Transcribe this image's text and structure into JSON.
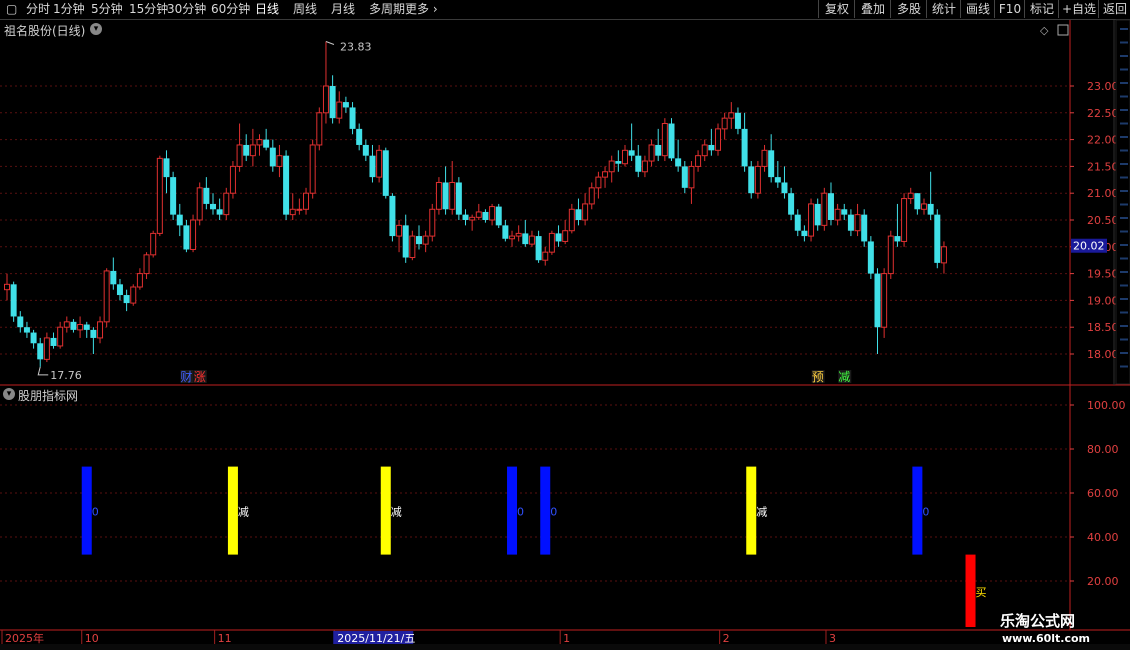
{
  "toolbar": {
    "periods": [
      "分时",
      "1分钟",
      "5分钟",
      "15分钟",
      "30分钟",
      "60分钟",
      "日线",
      "周线",
      "月线",
      "多周期",
      "更多"
    ],
    "active_period": "日线",
    "right_buttons": [
      "复权",
      "叠加",
      "多股",
      "统计",
      "画线",
      "F10",
      "标记",
      "+自选",
      "返回"
    ]
  },
  "stock": {
    "title": "祖名股份(日线)"
  },
  "indicator": {
    "title": "股朋指标网"
  },
  "colors": {
    "up": "#e03030",
    "down": "#40e0e8",
    "grid": "#5a1010",
    "axis": "#e04040"
  },
  "chart_data": [
    {
      "type": "candlestick",
      "title": "祖名股份(日线)",
      "y_ticks": [
        18.0,
        18.5,
        19.0,
        19.5,
        20.0,
        20.5,
        21.0,
        21.5,
        22.0,
        22.5,
        23.0
      ],
      "ylim": [
        17.4,
        23.95
      ],
      "current_price": "20.02",
      "max_label": "23.83",
      "min_label": "17.76",
      "event_markers": [
        {
          "index": 27,
          "text": "财",
          "color": "#4060ff"
        },
        {
          "index": 29,
          "text": "涨",
          "color": "#ff3030"
        },
        {
          "index": 122,
          "text": "预",
          "color": "#ffd040"
        },
        {
          "index": 126,
          "text": "减",
          "color": "#40ff40"
        }
      ],
      "candles": [
        [
          19.2,
          19.5,
          19.0,
          19.3
        ],
        [
          19.3,
          19.35,
          18.6,
          18.7
        ],
        [
          18.7,
          18.8,
          18.4,
          18.5
        ],
        [
          18.5,
          18.6,
          18.3,
          18.4
        ],
        [
          18.4,
          18.45,
          18.1,
          18.2
        ],
        [
          18.2,
          18.3,
          17.76,
          17.9
        ],
        [
          17.9,
          18.4,
          17.85,
          18.3
        ],
        [
          18.3,
          18.4,
          18.1,
          18.15
        ],
        [
          18.15,
          18.6,
          18.1,
          18.5
        ],
        [
          18.5,
          18.7,
          18.4,
          18.6
        ],
        [
          18.6,
          18.65,
          18.4,
          18.45
        ],
        [
          18.45,
          18.7,
          18.3,
          18.55
        ],
        [
          18.55,
          18.6,
          18.3,
          18.45
        ],
        [
          18.45,
          18.5,
          18.0,
          18.3
        ],
        [
          18.3,
          18.7,
          18.2,
          18.6
        ],
        [
          18.6,
          19.6,
          18.5,
          19.55
        ],
        [
          19.55,
          19.8,
          19.2,
          19.3
        ],
        [
          19.3,
          19.4,
          19.0,
          19.1
        ],
        [
          19.1,
          19.2,
          18.8,
          18.95
        ],
        [
          18.95,
          19.3,
          18.9,
          19.25
        ],
        [
          19.25,
          19.6,
          19.2,
          19.5
        ],
        [
          19.5,
          19.9,
          19.4,
          19.85
        ],
        [
          19.85,
          20.3,
          19.8,
          20.25
        ],
        [
          20.25,
          21.7,
          20.2,
          21.65
        ],
        [
          21.65,
          21.8,
          21.0,
          21.3
        ],
        [
          21.3,
          21.4,
          20.5,
          20.6
        ],
        [
          20.6,
          20.8,
          20.2,
          20.4
        ],
        [
          20.4,
          20.5,
          19.9,
          19.95
        ],
        [
          19.95,
          20.6,
          19.9,
          20.5
        ],
        [
          20.5,
          21.2,
          20.4,
          21.1
        ],
        [
          21.1,
          21.3,
          20.7,
          20.8
        ],
        [
          20.8,
          21.0,
          20.6,
          20.7
        ],
        [
          20.7,
          20.9,
          20.5,
          20.6
        ],
        [
          20.6,
          21.1,
          20.5,
          21.0
        ],
        [
          21.0,
          21.6,
          20.9,
          21.5
        ],
        [
          21.5,
          22.3,
          21.4,
          21.9
        ],
        [
          21.9,
          22.1,
          21.6,
          21.7
        ],
        [
          21.7,
          22.2,
          21.5,
          21.9
        ],
        [
          21.9,
          22.1,
          21.7,
          22.0
        ],
        [
          22.0,
          22.2,
          21.8,
          21.85
        ],
        [
          21.85,
          22.0,
          21.4,
          21.5
        ],
        [
          21.5,
          21.9,
          21.3,
          21.7
        ],
        [
          21.7,
          21.8,
          20.5,
          20.6
        ],
        [
          20.6,
          21.0,
          20.5,
          20.7
        ],
        [
          20.7,
          20.9,
          20.6,
          20.7
        ],
        [
          20.7,
          21.1,
          20.6,
          21.0
        ],
        [
          21.0,
          22.0,
          20.9,
          21.9
        ],
        [
          21.9,
          22.6,
          21.8,
          22.5
        ],
        [
          22.5,
          23.83,
          22.3,
          23.0
        ],
        [
          23.0,
          23.2,
          22.3,
          22.4
        ],
        [
          22.4,
          22.9,
          22.3,
          22.7
        ],
        [
          22.7,
          22.8,
          22.5,
          22.6
        ],
        [
          22.6,
          22.7,
          22.1,
          22.2
        ],
        [
          22.2,
          22.3,
          21.8,
          21.9
        ],
        [
          21.9,
          22.0,
          21.6,
          21.7
        ],
        [
          21.7,
          21.9,
          21.2,
          21.3
        ],
        [
          21.3,
          21.9,
          21.2,
          21.8
        ],
        [
          21.8,
          21.85,
          20.9,
          20.95
        ],
        [
          20.95,
          21.0,
          20.1,
          20.2
        ],
        [
          20.2,
          20.5,
          19.9,
          20.4
        ],
        [
          20.4,
          20.6,
          19.7,
          19.8
        ],
        [
          19.8,
          20.3,
          19.75,
          20.2
        ],
        [
          20.2,
          20.4,
          19.95,
          20.05
        ],
        [
          20.05,
          20.3,
          19.9,
          20.2
        ],
        [
          20.2,
          20.8,
          20.1,
          20.7
        ],
        [
          20.7,
          21.3,
          20.6,
          21.2
        ],
        [
          21.2,
          21.5,
          20.6,
          20.7
        ],
        [
          20.7,
          21.6,
          20.6,
          21.2
        ],
        [
          21.2,
          21.3,
          20.5,
          20.6
        ],
        [
          20.6,
          20.7,
          20.4,
          20.5
        ],
        [
          20.5,
          20.6,
          20.3,
          20.55
        ],
        [
          20.55,
          20.8,
          20.5,
          20.65
        ],
        [
          20.65,
          20.7,
          20.45,
          20.5
        ],
        [
          20.5,
          20.8,
          20.4,
          20.75
        ],
        [
          20.75,
          20.8,
          20.35,
          20.4
        ],
        [
          20.4,
          20.5,
          20.1,
          20.15
        ],
        [
          20.15,
          20.3,
          20.0,
          20.2
        ],
        [
          20.2,
          20.4,
          20.1,
          20.25
        ],
        [
          20.25,
          20.5,
          20.0,
          20.05
        ],
        [
          20.05,
          20.3,
          20.0,
          20.2
        ],
        [
          20.2,
          20.3,
          19.7,
          19.75
        ],
        [
          19.75,
          20.0,
          19.65,
          19.9
        ],
        [
          19.9,
          20.3,
          19.85,
          20.25
        ],
        [
          20.25,
          20.4,
          20.0,
          20.1
        ],
        [
          20.1,
          20.5,
          20.05,
          20.3
        ],
        [
          20.3,
          20.8,
          20.25,
          20.7
        ],
        [
          20.7,
          20.9,
          20.4,
          20.5
        ],
        [
          20.5,
          21.0,
          20.4,
          20.8
        ],
        [
          20.8,
          21.2,
          20.7,
          21.1
        ],
        [
          21.1,
          21.4,
          20.9,
          21.3
        ],
        [
          21.3,
          21.5,
          21.1,
          21.4
        ],
        [
          21.4,
          21.7,
          21.2,
          21.6
        ],
        [
          21.6,
          21.8,
          21.4,
          21.55
        ],
        [
          21.55,
          21.9,
          21.5,
          21.8
        ],
        [
          21.8,
          22.3,
          21.6,
          21.7
        ],
        [
          21.7,
          21.9,
          21.3,
          21.4
        ],
        [
          21.4,
          21.7,
          21.3,
          21.6
        ],
        [
          21.6,
          22.0,
          21.5,
          21.9
        ],
        [
          21.9,
          22.2,
          21.6,
          21.7
        ],
        [
          21.7,
          22.4,
          21.6,
          22.3
        ],
        [
          22.3,
          22.4,
          21.6,
          21.65
        ],
        [
          21.65,
          22.0,
          21.4,
          21.5
        ],
        [
          21.5,
          21.6,
          21.0,
          21.1
        ],
        [
          21.1,
          21.6,
          20.8,
          21.5
        ],
        [
          21.5,
          21.8,
          21.4,
          21.7
        ],
        [
          21.7,
          22.0,
          21.6,
          21.9
        ],
        [
          21.9,
          22.2,
          21.7,
          21.8
        ],
        [
          21.8,
          22.3,
          21.7,
          22.2
        ],
        [
          22.2,
          22.5,
          22.0,
          22.4
        ],
        [
          22.4,
          22.7,
          22.2,
          22.5
        ],
        [
          22.5,
          22.6,
          22.1,
          22.2
        ],
        [
          22.2,
          22.5,
          21.4,
          21.5
        ],
        [
          21.5,
          21.6,
          20.9,
          21.0
        ],
        [
          21.0,
          21.6,
          20.9,
          21.5
        ],
        [
          21.5,
          21.9,
          21.4,
          21.8
        ],
        [
          21.8,
          22.1,
          21.2,
          21.3
        ],
        [
          21.3,
          21.6,
          21.1,
          21.2
        ],
        [
          21.2,
          21.5,
          20.9,
          21.0
        ],
        [
          21.0,
          21.1,
          20.5,
          20.6
        ],
        [
          20.6,
          20.7,
          20.2,
          20.3
        ],
        [
          20.3,
          20.4,
          20.1,
          20.2
        ],
        [
          20.2,
          20.9,
          20.1,
          20.8
        ],
        [
          20.8,
          20.9,
          20.3,
          20.4
        ],
        [
          20.4,
          21.1,
          20.3,
          21.0
        ],
        [
          21.0,
          21.2,
          20.4,
          20.5
        ],
        [
          20.5,
          20.8,
          20.4,
          20.7
        ],
        [
          20.7,
          20.8,
          20.5,
          20.6
        ],
        [
          20.6,
          20.7,
          20.2,
          20.3
        ],
        [
          20.3,
          20.8,
          20.2,
          20.6
        ],
        [
          20.6,
          20.7,
          20.0,
          20.1
        ],
        [
          20.1,
          20.2,
          19.4,
          19.5
        ],
        [
          19.5,
          19.6,
          18.0,
          18.5
        ],
        [
          18.5,
          19.6,
          18.3,
          19.5
        ],
        [
          19.5,
          20.3,
          19.4,
          20.2
        ],
        [
          20.2,
          20.8,
          20.0,
          20.1
        ],
        [
          20.1,
          21.0,
          20.0,
          20.9
        ],
        [
          20.9,
          21.1,
          20.8,
          21.0
        ],
        [
          21.0,
          21.0,
          20.6,
          20.7
        ],
        [
          20.7,
          20.9,
          20.6,
          20.8
        ],
        [
          20.8,
          21.4,
          20.5,
          20.6
        ],
        [
          20.6,
          20.7,
          19.6,
          19.7
        ],
        [
          19.7,
          20.1,
          19.5,
          20.0
        ]
      ]
    },
    {
      "type": "bar",
      "title": "股朋指标网",
      "y_ticks": [
        20.0,
        40.0,
        60.0,
        80.0,
        100.0
      ],
      "ylim": [
        0,
        106
      ],
      "bars": [
        {
          "index": 12,
          "bottom": 32,
          "top": 72,
          "color": "#0010ff",
          "label": "0"
        },
        {
          "index": 34,
          "bottom": 32,
          "top": 72,
          "color": "#ffff00",
          "label": "减"
        },
        {
          "index": 57,
          "bottom": 32,
          "top": 72,
          "color": "#ffff00",
          "label": "减"
        },
        {
          "index": 76,
          "bottom": 32,
          "top": 72,
          "color": "#0010ff",
          "label": "0"
        },
        {
          "index": 81,
          "bottom": 32,
          "top": 72,
          "color": "#0010ff",
          "label": "0"
        },
        {
          "index": 112,
          "bottom": 32,
          "top": 72,
          "color": "#ffff00",
          "label": "减"
        },
        {
          "index": 137,
          "bottom": 32,
          "top": 72,
          "color": "#0010ff",
          "label": "0"
        },
        {
          "index": 145,
          "bottom": 0,
          "top": 32,
          "color": "#ff0000",
          "label": "买"
        }
      ]
    }
  ],
  "date_axis": [
    {
      "index": 0,
      "text": "2025年"
    },
    {
      "index": 12,
      "text": "10"
    },
    {
      "index": 32,
      "text": "11"
    },
    {
      "index": 50,
      "text": "2025/11/21/五",
      "highlight": true
    },
    {
      "index": 84,
      "text": "1"
    },
    {
      "index": 108,
      "text": "2"
    },
    {
      "index": 124,
      "text": "3"
    }
  ],
  "watermark": {
    "main": "乐淘公式网",
    "sub": "www.60lt.com"
  }
}
